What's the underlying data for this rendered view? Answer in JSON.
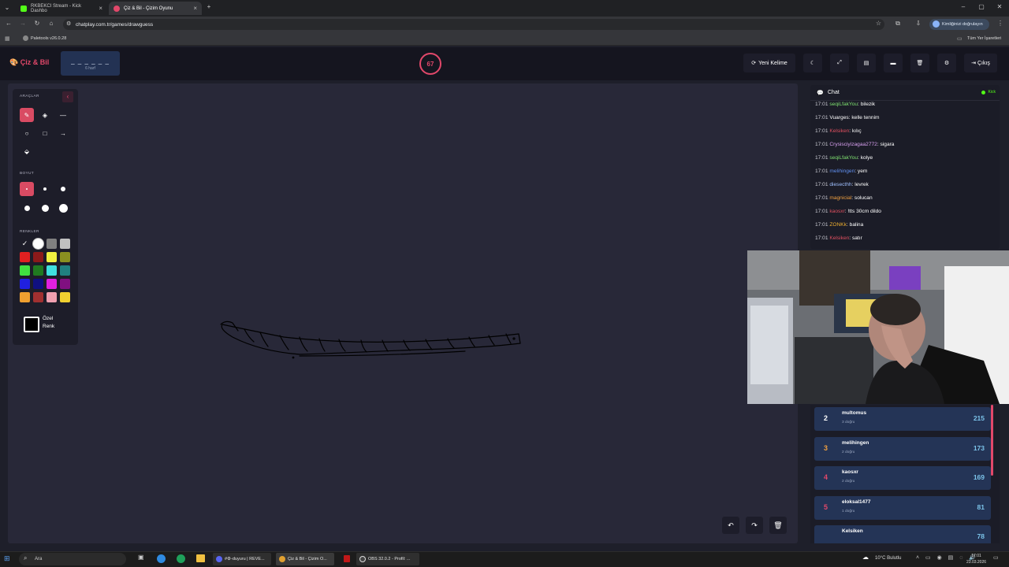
{
  "browser": {
    "tabs": [
      {
        "title": "RKBEKCI Stream - Kick Dashbo",
        "favicon_color": "#53fc18",
        "active": false
      },
      {
        "title": "Çiz & Bil - Çizim Oyunu",
        "favicon_color": "#e2486a",
        "active": true
      }
    ],
    "url": "chatplay.com.tr/games/drawguess",
    "verify_label": "Kimliğinizi doğrulayın",
    "bookmark": "Paletools v26.0.28",
    "all_bookmarks": "Tüm Yer İşaretleri"
  },
  "app": {
    "logo": "Çiz & Bil",
    "word_dashes": "_ _ _ _ _ _",
    "word_letters": "6 harf",
    "timer": "67",
    "new_word": "Yeni Kelime",
    "exit": "Çıkış"
  },
  "tools": {
    "tools_label": "ARAÇLAR",
    "size_label": "BOYUT",
    "colors_label": "RENKLER",
    "custom_color_1": "Özel",
    "custom_color_2": "Renk",
    "colors": [
      "#000000",
      "#ffffff",
      "#808080",
      "#c0c0c0",
      "#e02020",
      "#8b1a1a",
      "#f0f040",
      "#8a9020",
      "#40e040",
      "#207a20",
      "#40e0e0",
      "#208080",
      "#2020e0",
      "#101080",
      "#e020e0",
      "#801080",
      "#f0a030",
      "#a03030",
      "#f0a0b0",
      "#f0d030"
    ]
  },
  "chat": {
    "title": "Chat",
    "status": "Kick",
    "messages": [
      {
        "time": "17:01",
        "user": "seqiLfakYou",
        "color": "#7ee070",
        "text": "bilezik"
      },
      {
        "time": "17:01",
        "user": "Vuarges",
        "color": "#ffffff",
        "text": "kelle tennim"
      },
      {
        "time": "17:01",
        "user": "Kelsiken",
        "color": "#e05060",
        "text": "kılıç"
      },
      {
        "time": "17:01",
        "user": "Crysisciyizagaa2772",
        "color": "#d8a0f0",
        "text": "sigara"
      },
      {
        "time": "17:01",
        "user": "seqiLfakYou",
        "color": "#7ee070",
        "text": "kolye"
      },
      {
        "time": "17:01",
        "user": "melihingen",
        "color": "#6090f0",
        "text": "yem"
      },
      {
        "time": "17:01",
        "user": "diesecthh",
        "color": "#a0c0ff",
        "text": "levrek"
      },
      {
        "time": "17:01",
        "user": "magnicial",
        "color": "#f0a040",
        "text": "solucan"
      },
      {
        "time": "17:01",
        "user": "kaosxr",
        "color": "#e05060",
        "text": "!tts 30cm dildo"
      },
      {
        "time": "17:01",
        "user": "ZONKk",
        "color": "#f0b030",
        "text": "balina"
      },
      {
        "time": "17:01",
        "user": "Kelsiken",
        "color": "#e05060",
        "text": "satır"
      }
    ]
  },
  "leaderboard": [
    {
      "rank": "2",
      "name": "multomus",
      "sub": "3 doğru",
      "score": "215",
      "rank_color": "#ffffff"
    },
    {
      "rank": "3",
      "name": "melihingen",
      "sub": "2 doğru",
      "score": "173",
      "rank_color": "#f0a040"
    },
    {
      "rank": "4",
      "name": "kaosxr",
      "sub": "2 doğru",
      "score": "169",
      "rank_color": "#e2486a"
    },
    {
      "rank": "5",
      "name": "eloksal1477",
      "sub": "1 doğru",
      "score": "81",
      "rank_color": "#e2486a"
    },
    {
      "rank": "",
      "name": "Kelsiken",
      "sub": "",
      "score": "78",
      "rank_color": "#e2486a"
    }
  ],
  "taskbar": {
    "search": "Ara",
    "apps": [
      {
        "label": "#⚙-duyuru | REVE..."
      },
      {
        "label": "Çiz & Bil - Çizim O..."
      },
      {
        "label": "OBS 32.0.2 - Profil: ..."
      }
    ],
    "weather": "10°C Bulutlu",
    "time": "17:01",
    "date": "23.03.2026"
  }
}
